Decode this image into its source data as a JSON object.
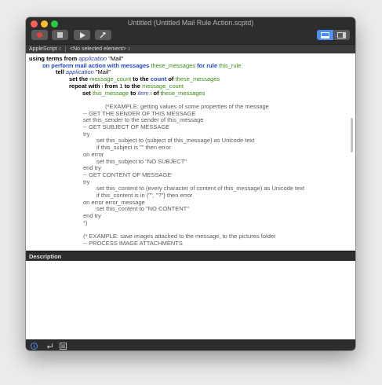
{
  "window": {
    "title": "Untitled (Untitled Mail Rule Action.scptd)"
  },
  "toolbar": {
    "buttons": [
      {
        "name": "record",
        "icon": "record-icon"
      },
      {
        "name": "stop",
        "icon": "stop-icon"
      },
      {
        "name": "run",
        "icon": "play-icon"
      },
      {
        "name": "compile",
        "icon": "hammer-icon"
      }
    ],
    "view_toggle": [
      "split-view-icon",
      "sidebar-icon"
    ]
  },
  "navbar": {
    "language": "AppleScript ↕",
    "element": "<No selected element> ↕"
  },
  "code": [
    [
      [
        "kw",
        "using terms from "
      ],
      [
        "cls",
        "application"
      ],
      [
        "str",
        " \"Mail\""
      ]
    ],
    [
      [
        "hdl",
        "on perform mail action with messages "
      ],
      [
        "var",
        "these_messages"
      ],
      [
        "hdl",
        " for rule "
      ],
      [
        "var",
        "this_rule"
      ]
    ],
    [
      [
        "kw",
        "tell "
      ],
      [
        "cls",
        "application"
      ],
      [
        "str",
        " \"Mail\""
      ]
    ],
    [
      [
        "kw",
        "set the "
      ],
      [
        "var",
        "message_count"
      ],
      [
        "kw",
        " to the "
      ],
      [
        "hdl",
        "count"
      ],
      [
        "kw",
        " of "
      ],
      [
        "var",
        "these_messages"
      ]
    ],
    [
      [
        "kw",
        "repeat with "
      ],
      [
        "var",
        "i"
      ],
      [
        "kw",
        " from "
      ],
      [
        "num",
        "1"
      ],
      [
        "kw",
        " to the "
      ],
      [
        "var",
        "message_count"
      ]
    ],
    [
      [
        "kw",
        "set "
      ],
      [
        "var",
        "this_message"
      ],
      [
        "kw",
        " to "
      ],
      [
        "cls",
        "item"
      ],
      [
        "str",
        " "
      ],
      [
        "var",
        "i"
      ],
      [
        "kw",
        " of "
      ],
      [
        "var",
        "these_messages"
      ]
    ],
    [],
    [
      [
        "com",
        "(*EXAMPLE: getting values of some properties of the message"
      ]
    ],
    [
      [
        "com",
        "-- GET THE SENDER OF THIS MESSAGE"
      ]
    ],
    [
      [
        "com",
        "set this_sender to the sender of this_message"
      ]
    ],
    [
      [
        "com",
        "-- GET SUBJECT OF MESSAGE"
      ]
    ],
    [
      [
        "com",
        "try"
      ]
    ],
    [
      [
        "com",
        "set this_subject to (subject of this_message) as Unicode text"
      ]
    ],
    [
      [
        "com",
        "if this_subject is \"\" then error"
      ]
    ],
    [
      [
        "com",
        "on error"
      ]
    ],
    [
      [
        "com",
        "set this_subject to \"NO SUBJECT\""
      ]
    ],
    [
      [
        "com",
        "end try"
      ]
    ],
    [
      [
        "com",
        "-- GET CONTENT OF MESSAGE"
      ]
    ],
    [
      [
        "com",
        "try"
      ]
    ],
    [
      [
        "com",
        "set this_content to (every character of content of this_message) as Unicode text"
      ]
    ],
    [
      [
        "com",
        "if this_content is in {\"\", \"?\"} then error"
      ]
    ],
    [
      [
        "com",
        "on error error_message"
      ]
    ],
    [
      [
        "com",
        "set this_content to \"NO CONTENT\""
      ]
    ],
    [
      [
        "com",
        "end try"
      ]
    ],
    [
      [
        "com",
        "*)"
      ]
    ],
    [],
    [
      [
        "com",
        "(* EXAMPLE: save images attached to the message, to the pictures folder"
      ]
    ],
    [
      [
        "com",
        "-- PROCESS IMAGE ATTACHMENTS"
      ]
    ]
  ],
  "description_pane": {
    "title": "Description",
    "content": ""
  },
  "bottombar": {
    "icons": [
      "info-icon",
      "return-icon",
      "log-icon"
    ]
  },
  "colors": {
    "keyword": "#000000",
    "handler": "#2445c2",
    "class": "#2f3ea8",
    "variable": "#3c8b12",
    "comment": "#5b5b5b",
    "chrome": "#2d2d2d",
    "accent": "#4b8ff2"
  }
}
